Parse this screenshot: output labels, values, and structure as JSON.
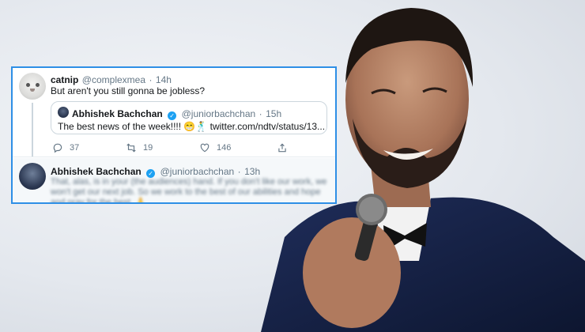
{
  "colors": {
    "card_border": "#2e8fe6",
    "verified": "#1da1f2",
    "muted": "#657786",
    "text": "#14171a"
  },
  "tweet1": {
    "name": "catnip",
    "handle": "@complexmea",
    "sep": "·",
    "time": "14h",
    "text": "But aren't you still gonna be jobless?",
    "avatar": "cat-avatar",
    "actions": {
      "reply_icon": "reply-icon",
      "reply_count": "37",
      "retweet_icon": "retweet-icon",
      "retweet_count": "19",
      "like_icon": "heart-icon",
      "like_count": "146",
      "share_icon": "share-icon"
    }
  },
  "quote": {
    "name": "Abhishek Bachchan",
    "handle": "@juniorbachchan",
    "sep": "·",
    "time": "15h",
    "text": "The best news of the week!!!! 😁🕺 twitter.com/ndtv/status/13...",
    "verified_icon": "verified-badge-icon"
  },
  "tweet2": {
    "name": "Abhishek Bachchan",
    "handle": "@juniorbachchan",
    "sep": "·",
    "time": "13h",
    "text": "That, alas, is in your (the audiences) hand. If you don't like our work, we won't get our next job. So we work to the best of our abilities and hope and pray for the best. 🙏",
    "verified_icon": "verified-badge-icon"
  }
}
